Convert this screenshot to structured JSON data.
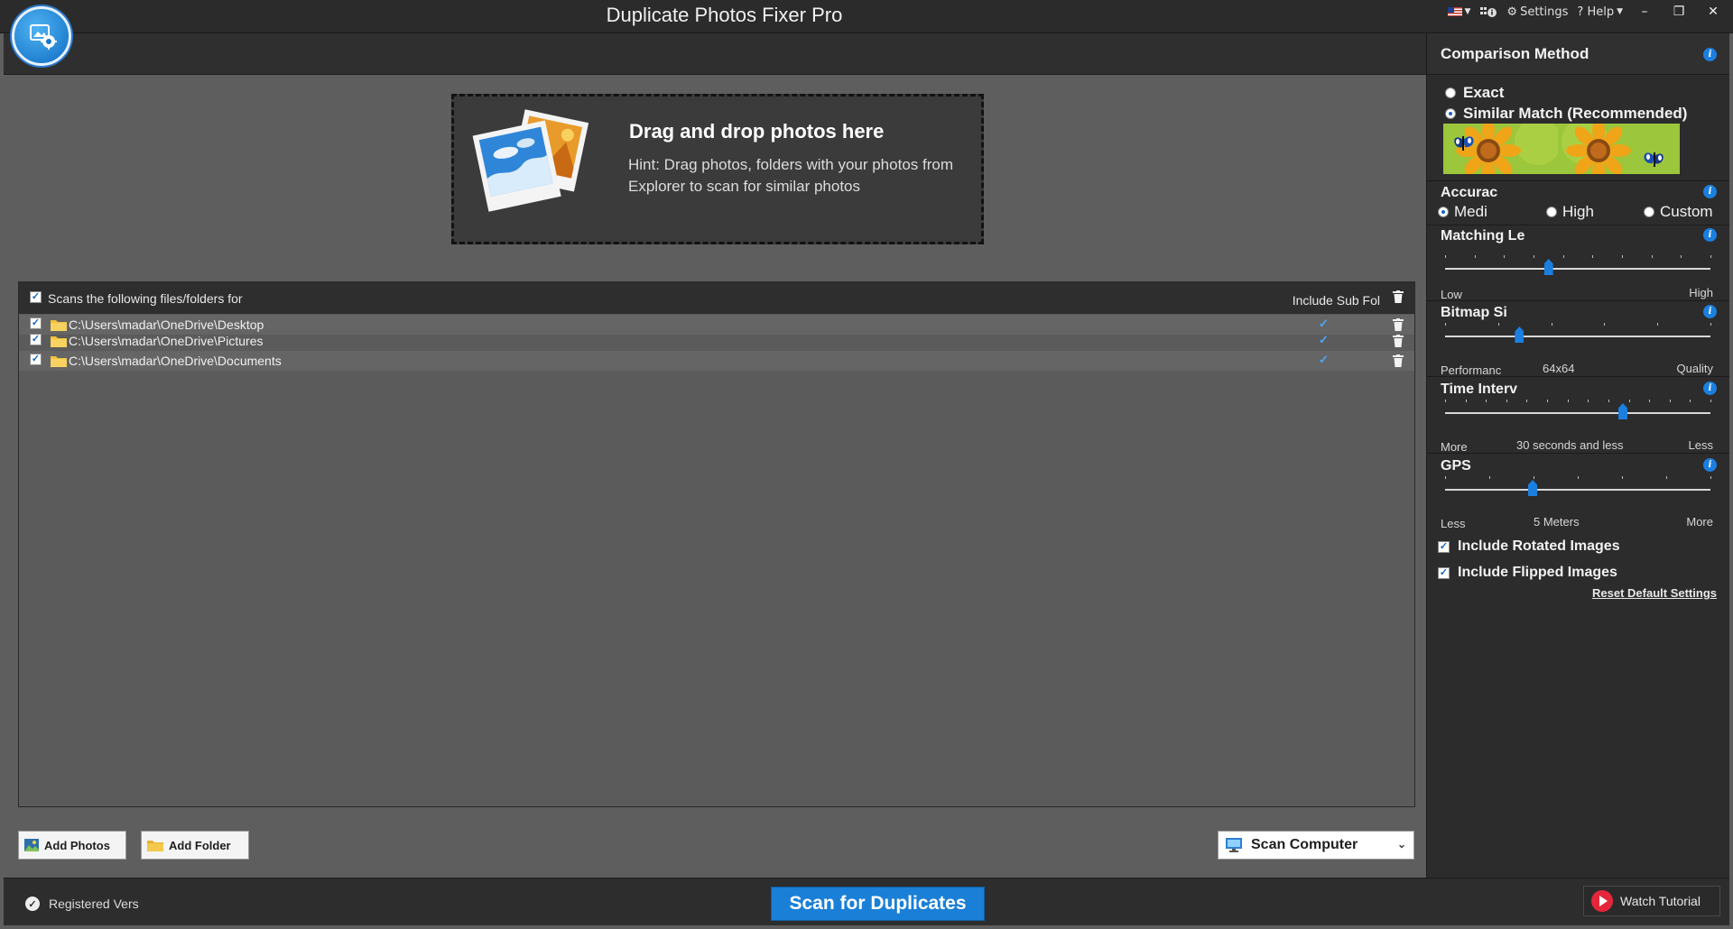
{
  "window": {
    "title": "Duplicate Photos Fixer Pro",
    "settings_label": "Settings",
    "help_label": "? Help",
    "minimize": "–",
    "maximize": "❐",
    "close": "✕"
  },
  "dropzone": {
    "title": "Drag and drop photos here",
    "hint": "Hint: Drag photos, folders with your photos from Explorer to scan for similar photos"
  },
  "scan_list": {
    "header_label": "Scans the following files/folders for",
    "sub_folders_label": "Include Sub Fol",
    "folders": [
      {
        "path": "C:\\Users\\madar\\OneDrive\\Desktop",
        "checked": true,
        "include_sub": true
      },
      {
        "path": "C:\\Users\\madar\\OneDrive\\Pictures",
        "checked": true,
        "include_sub": true
      },
      {
        "path": "C:\\Users\\madar\\OneDrive\\Documents",
        "checked": true,
        "include_sub": true
      }
    ]
  },
  "actions": {
    "add_photos": "Add Photos",
    "add_folder": "Add Folder",
    "scan_location": "Scan Computer",
    "scan_button": "Scan for Duplicates",
    "watch_tutorial": "Watch Tutorial"
  },
  "status": {
    "registered": "Registered Vers"
  },
  "comparison": {
    "title": "Comparison Method",
    "method_exact": "Exact",
    "method_similar": "Similar Match (Recommended)",
    "selected_method": "similar",
    "accuracy": {
      "title": "Accurac",
      "options": [
        "Medi",
        "High",
        "Custom"
      ],
      "selected": "Medi"
    },
    "matching_level": {
      "title": "Matching Le",
      "low": "Low",
      "high": "High",
      "value": 0.39
    },
    "bitmap_size": {
      "title": "Bitmap Si",
      "left": "Performanc",
      "center": "64x64",
      "right": "Quality",
      "value": 0.28
    },
    "time_interval": {
      "title": "Time Interv",
      "left": "More",
      "center": "30 seconds and less",
      "right": "Less",
      "value": 0.67
    },
    "gps": {
      "title": "GPS",
      "left": "Less",
      "center": "5 Meters",
      "right": "More",
      "value": 0.33
    },
    "include_rotated": "Include Rotated Images",
    "include_flipped": "Include Flipped Images",
    "reset": "Reset Default Settings"
  },
  "colors": {
    "accent": "#1a7fd6",
    "panel": "#2c2c2c",
    "canvas": "#5e5e5e"
  }
}
